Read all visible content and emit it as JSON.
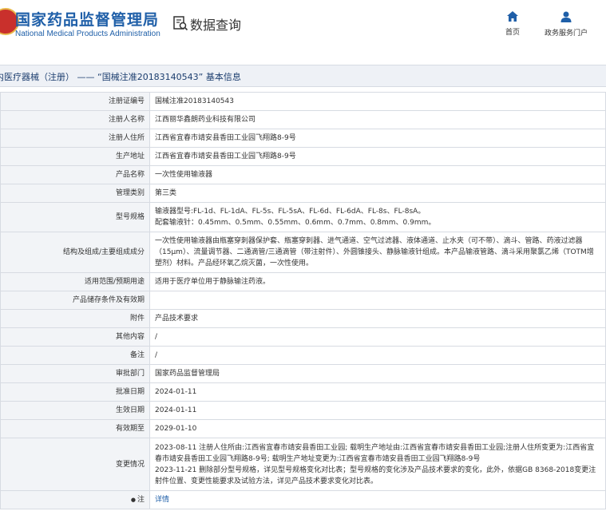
{
  "header": {
    "org_cn": "国家药品监督管理局",
    "org_en": "National Medical Products Administration",
    "query_label": "数据查询",
    "nav": [
      {
        "label": "首页",
        "icon": "home-icon"
      },
      {
        "label": "政务服务门户",
        "icon": "user-icon"
      }
    ]
  },
  "breadcrumb": "内医疗器械（注册） —— “国械注准20183140543” 基本信息",
  "rows": [
    {
      "label": "注册证编号",
      "value": "国械注准20183140543"
    },
    {
      "label": "注册人名称",
      "value": "江西丽华鑫朗药业科技有限公司"
    },
    {
      "label": "注册人住所",
      "value": "江西省宜春市靖安县香田工业园飞翔路8-9号"
    },
    {
      "label": "生产地址",
      "value": "江西省宜春市靖安县香田工业园飞翔路8-9号"
    },
    {
      "label": "产品名称",
      "value": "一次性使用输液器"
    },
    {
      "label": "管理类别",
      "value": "第三类"
    },
    {
      "label": "型号规格",
      "value": "输液器型号:FL-1d、FL-1dA、FL-5s、FL-5sA、FL-6d、FL-6dA、FL-8s、FL-8sA。\n配套输液针：0.45mm、0.5mm、0.55mm、0.6mm、0.7mm、0.8mm、0.9mm。"
    },
    {
      "label": "结构及组成/主要组成成分",
      "value": "一次性使用输液器由瓶塞穿刺器保护套、瓶塞穿刺器、进气通道、空气过滤器、液体通道、止水夹（可不带）、滴斗、管路、药液过滤器（15μm）、流量调节器、二通滴管/三通滴管（带注射件）、外圆锥接头、静脉输液针组成。本产品输液管路、滴斗采用聚氯乙烯（TOTM增塑剂）材料。产品经环氧乙烷灭菌，一次性使用。"
    },
    {
      "label": "适用范围/预期用途",
      "value": "适用于医疗单位用于静脉输注药液。"
    },
    {
      "label": "产品储存条件及有效期",
      "value": ""
    },
    {
      "label": "附件",
      "value": "产品技术要求"
    },
    {
      "label": "其他内容",
      "value": "/"
    },
    {
      "label": "备注",
      "value": "/"
    },
    {
      "label": "审批部门",
      "value": "国家药品监督管理局"
    },
    {
      "label": "批准日期",
      "value": "2024-01-11"
    },
    {
      "label": "生效日期",
      "value": "2024-01-11"
    },
    {
      "label": "有效期至",
      "value": "2029-01-10"
    },
    {
      "label": "变更情况",
      "value": "2023-08-11 注册人住所由:江西省宜春市靖安县香田工业园; 载明生产地址由:江西省宜春市靖安县香田工业园;注册人住所变更为:江西省宜春市靖安县香田工业园飞翔路8-9号; 载明生产地址变更为:江西省宜春市靖安县香田工业园飞翔路8-9号\n2023-11-21 删除部分型号规格，详见型号规格变化对比表；型号规格的变化涉及产品技术要求的变化，此外，依据GB 8368-2018变更注射件位置、变更性能要求及试验方法，详见产品技术要求变化对比表。"
    },
    {
      "label": "注",
      "value": "详情",
      "link": true
    }
  ]
}
